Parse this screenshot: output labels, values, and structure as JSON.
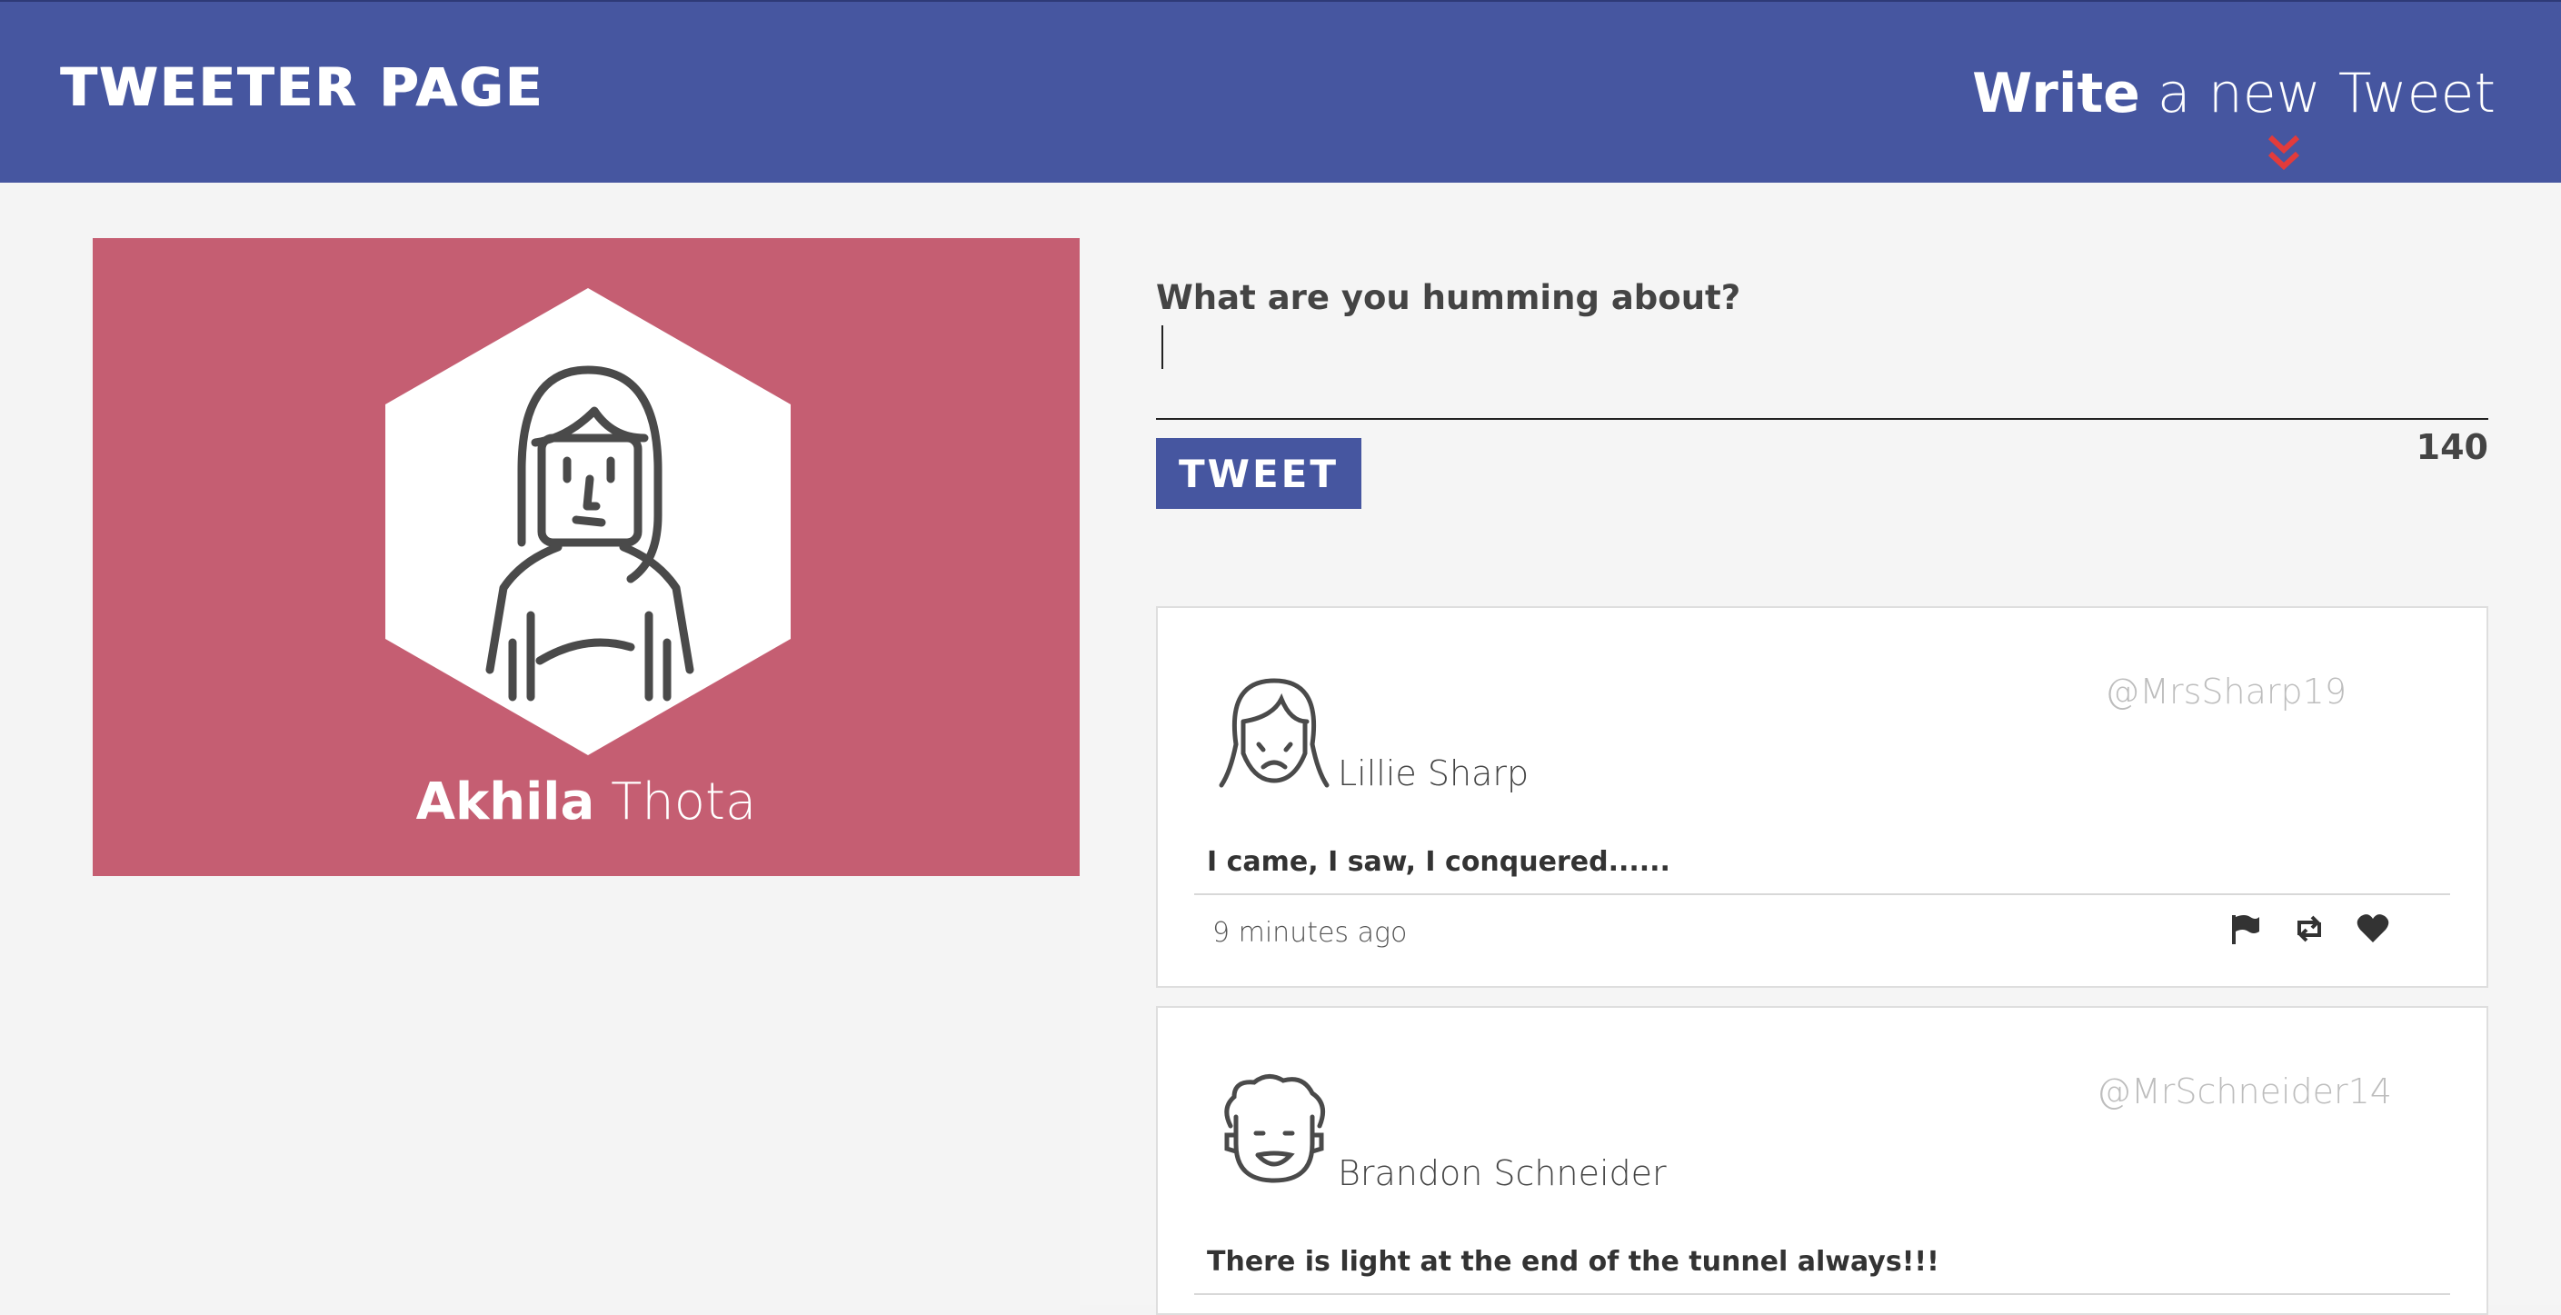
{
  "header": {
    "brand": "TWEETER PAGE",
    "compose_bold": "Write",
    "compose_rest": " a new Tweet"
  },
  "profile": {
    "first_name": "Akhila",
    "last_name": " Thota"
  },
  "composer": {
    "prompt": "What are you humming about?",
    "value": "",
    "button_label": "TWEET",
    "char_count": "140"
  },
  "tweets": [
    {
      "author": "Lillie Sharp",
      "handle": "@MrsSharp19",
      "content": "I came, I saw, I conquered......",
      "time": "9 minutes ago"
    },
    {
      "author": "Brandon Schneider",
      "handle": "@MrSchneider14",
      "content": "There is light at the end of the tunnel always!!!",
      "time": ""
    }
  ],
  "icons": {
    "scroll_arrow": "double-chevron-down-icon",
    "flag": "flag-icon",
    "retweet": "retweet-icon",
    "like": "heart-icon"
  },
  "colors": {
    "nav": "#4656a0",
    "profile_card": "#c55e72",
    "accent_arrow": "#e23b3b"
  }
}
